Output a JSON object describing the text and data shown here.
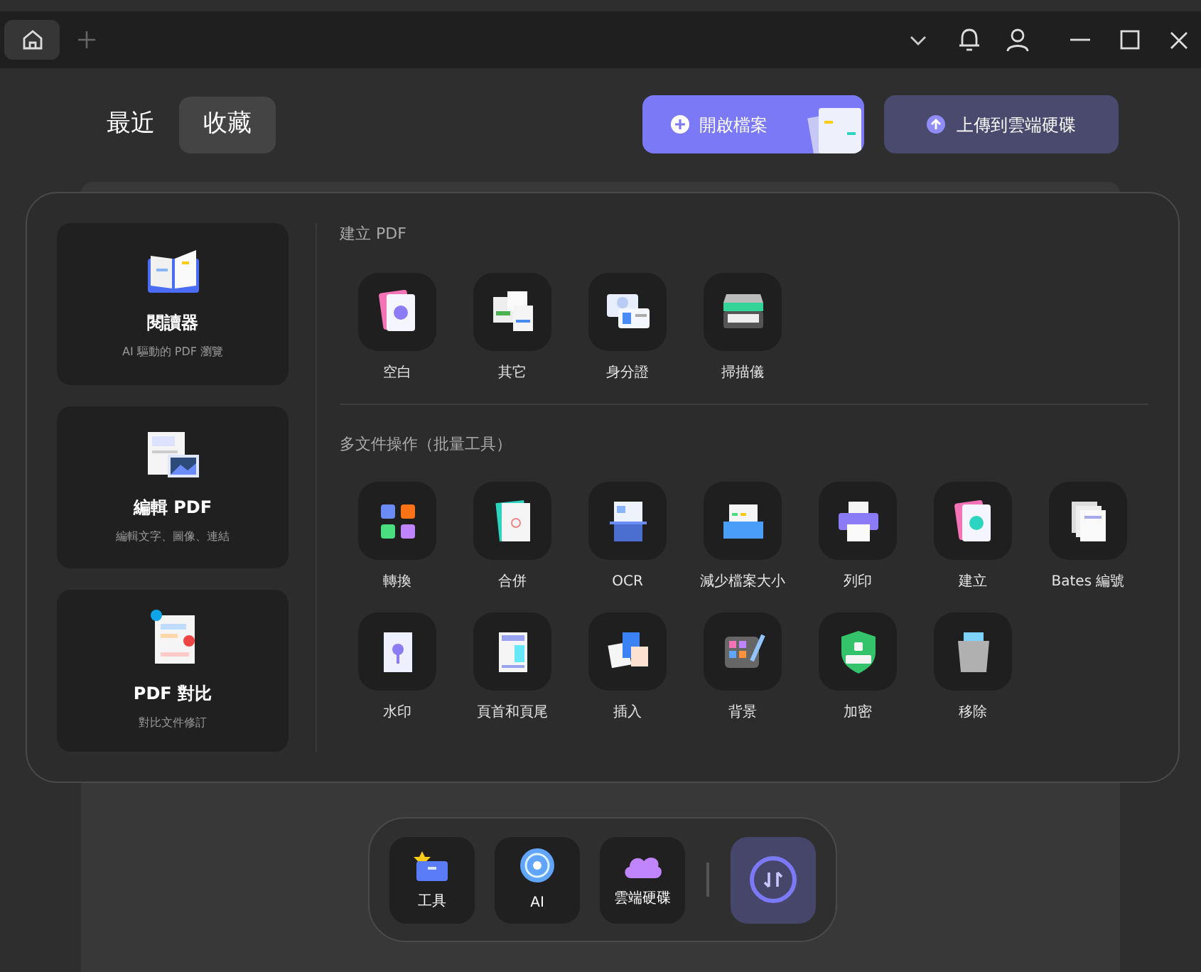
{
  "tabs": [
    {
      "label": "最近",
      "selected": false
    },
    {
      "label": "收藏",
      "selected": true
    }
  ],
  "actions": [
    {
      "label": "開啟檔案",
      "kind": "primary"
    },
    {
      "label": "上傳到雲端硬碟",
      "kind": "secondary"
    }
  ],
  "features": [
    {
      "title": "閱讀器",
      "subtitle": "AI 驅動的 PDF 瀏覽"
    },
    {
      "title": "編輯 PDF",
      "subtitle": "編輯文字、圖像、連結"
    },
    {
      "title": "PDF 對比",
      "subtitle": "對比文件修訂"
    }
  ],
  "sections": [
    {
      "title": "建立 PDF",
      "tools": [
        "空白",
        "其它",
        "身分證",
        "掃描儀"
      ]
    },
    {
      "title": "多文件操作（批量工具）",
      "tools": [
        "轉換",
        "合併",
        "OCR",
        "減少檔案大小",
        "列印",
        "建立",
        "Bates 編號",
        "水印",
        "頁首和頁尾",
        "插入",
        "背景",
        "加密",
        "移除"
      ]
    }
  ],
  "dock": [
    {
      "label": "工具"
    },
    {
      "label": "AI"
    },
    {
      "label": "雲端硬碟"
    }
  ]
}
